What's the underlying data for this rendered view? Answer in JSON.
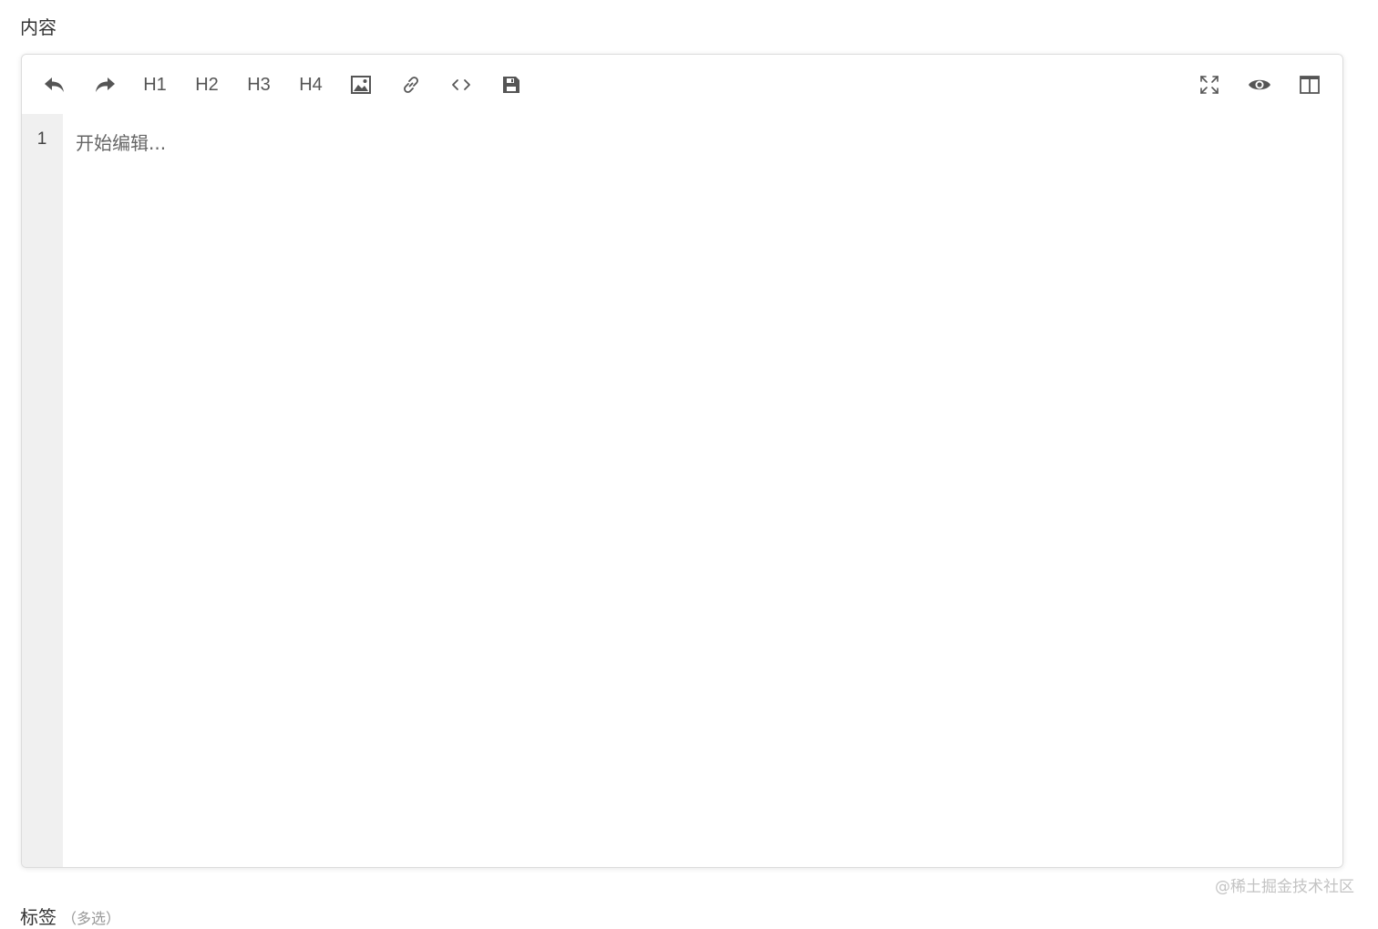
{
  "content_section": {
    "label": "内容"
  },
  "toolbar": {
    "left_items": [
      {
        "name": "undo-button",
        "icon": "undo-icon"
      },
      {
        "name": "redo-button",
        "icon": "redo-icon"
      },
      {
        "name": "h1-button",
        "label": "H1"
      },
      {
        "name": "h2-button",
        "label": "H2"
      },
      {
        "name": "h3-button",
        "label": "H3"
      },
      {
        "name": "h4-button",
        "label": "H4"
      },
      {
        "name": "insert-image-button",
        "icon": "image-icon"
      },
      {
        "name": "insert-link-button",
        "icon": "link-icon"
      },
      {
        "name": "insert-code-button",
        "icon": "code-icon"
      },
      {
        "name": "save-button",
        "icon": "save-icon"
      }
    ],
    "right_items": [
      {
        "name": "fullscreen-button",
        "icon": "expand-icon"
      },
      {
        "name": "preview-button",
        "icon": "eye-icon"
      },
      {
        "name": "split-view-button",
        "icon": "columns-icon"
      }
    ],
    "h1_label": "H1",
    "h2_label": "H2",
    "h3_label": "H3",
    "h4_label": "H4"
  },
  "editor": {
    "line_numbers": [
      "1"
    ],
    "placeholder": "开始编辑..."
  },
  "tags_section": {
    "label": "标签",
    "hint": "（多选）"
  },
  "watermark": "@稀土掘金技术社区",
  "colors": {
    "icon": "#555555",
    "gutter_bg": "#f0f0f0",
    "border": "#dcdcdc",
    "placeholder": "#666666",
    "watermark": "#c3c3c3"
  }
}
